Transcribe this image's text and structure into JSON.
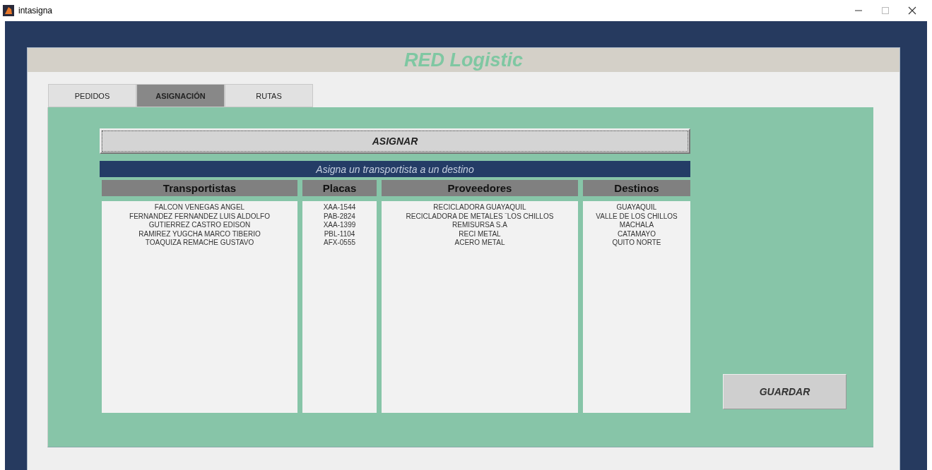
{
  "window": {
    "title": "intasigna"
  },
  "app_title": "RED Logistic",
  "tabs": [
    {
      "label": "PEDIDOS",
      "selected": false
    },
    {
      "label": "ASIGNACIÓN",
      "selected": true
    },
    {
      "label": "RUTAS",
      "selected": false
    }
  ],
  "assign_button": "ASIGNAR",
  "banner": "Asigna un transportista a un destino",
  "columns": [
    {
      "heading": "Transportistas",
      "items": [
        "FALCON VENEGAS ANGEL",
        "FERNANDEZ FERNANDEZ LUIS ALDOLFO",
        "GUTIERREZ CASTRO EDISON",
        "RAMIREZ YUGCHA MARCO TIBERIO",
        "TOAQUIZA REMACHE GUSTAVO"
      ]
    },
    {
      "heading": "Placas",
      "items": [
        "XAA-1544",
        "PAB-2824",
        "XAA-1399",
        "PBL-1104",
        "AFX-0555"
      ]
    },
    {
      "heading": "Proveedores",
      "items": [
        "RECICLADORA GUAYAQUIL",
        "RECICLADORA DE METALES ¨LOS CHILLOS",
        "REMISURSA S.A",
        "RECI METAL",
        "ACERO METAL"
      ]
    },
    {
      "heading": "Destinos",
      "items": [
        "GUAYAQUIL",
        "VALLE DE LOS CHILLOS",
        "MACHALA",
        "CATAMAYO",
        "QUITO NORTE"
      ]
    }
  ],
  "save_button": "GUARDAR"
}
